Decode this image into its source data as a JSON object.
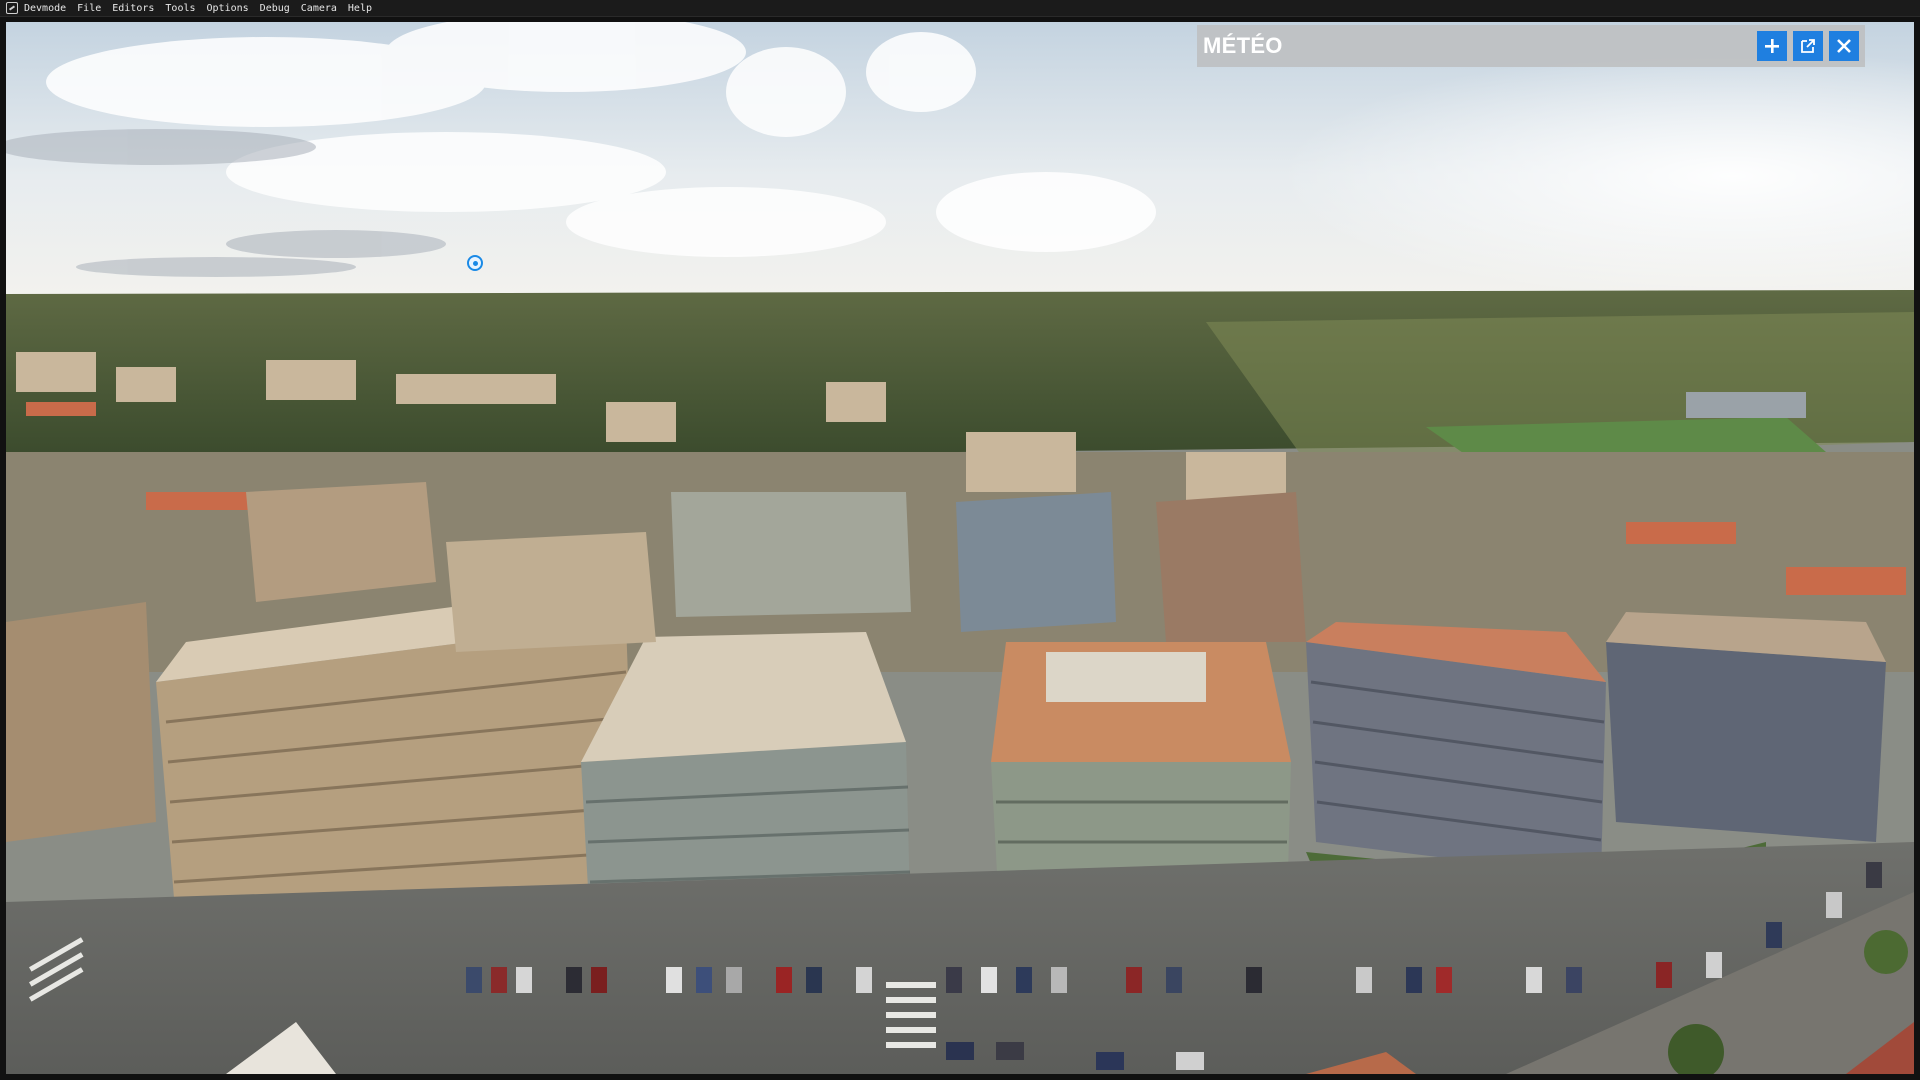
{
  "menubar": {
    "items": [
      "Devmode",
      "File",
      "Editors",
      "Tools",
      "Options",
      "Debug",
      "Camera",
      "Help"
    ]
  },
  "meteo_panel": {
    "title": "MÉTÉO",
    "buttons": {
      "add": "plus-icon",
      "popout": "external-window-icon",
      "close": "close-icon"
    },
    "accent_color": "#1f7fe0"
  }
}
